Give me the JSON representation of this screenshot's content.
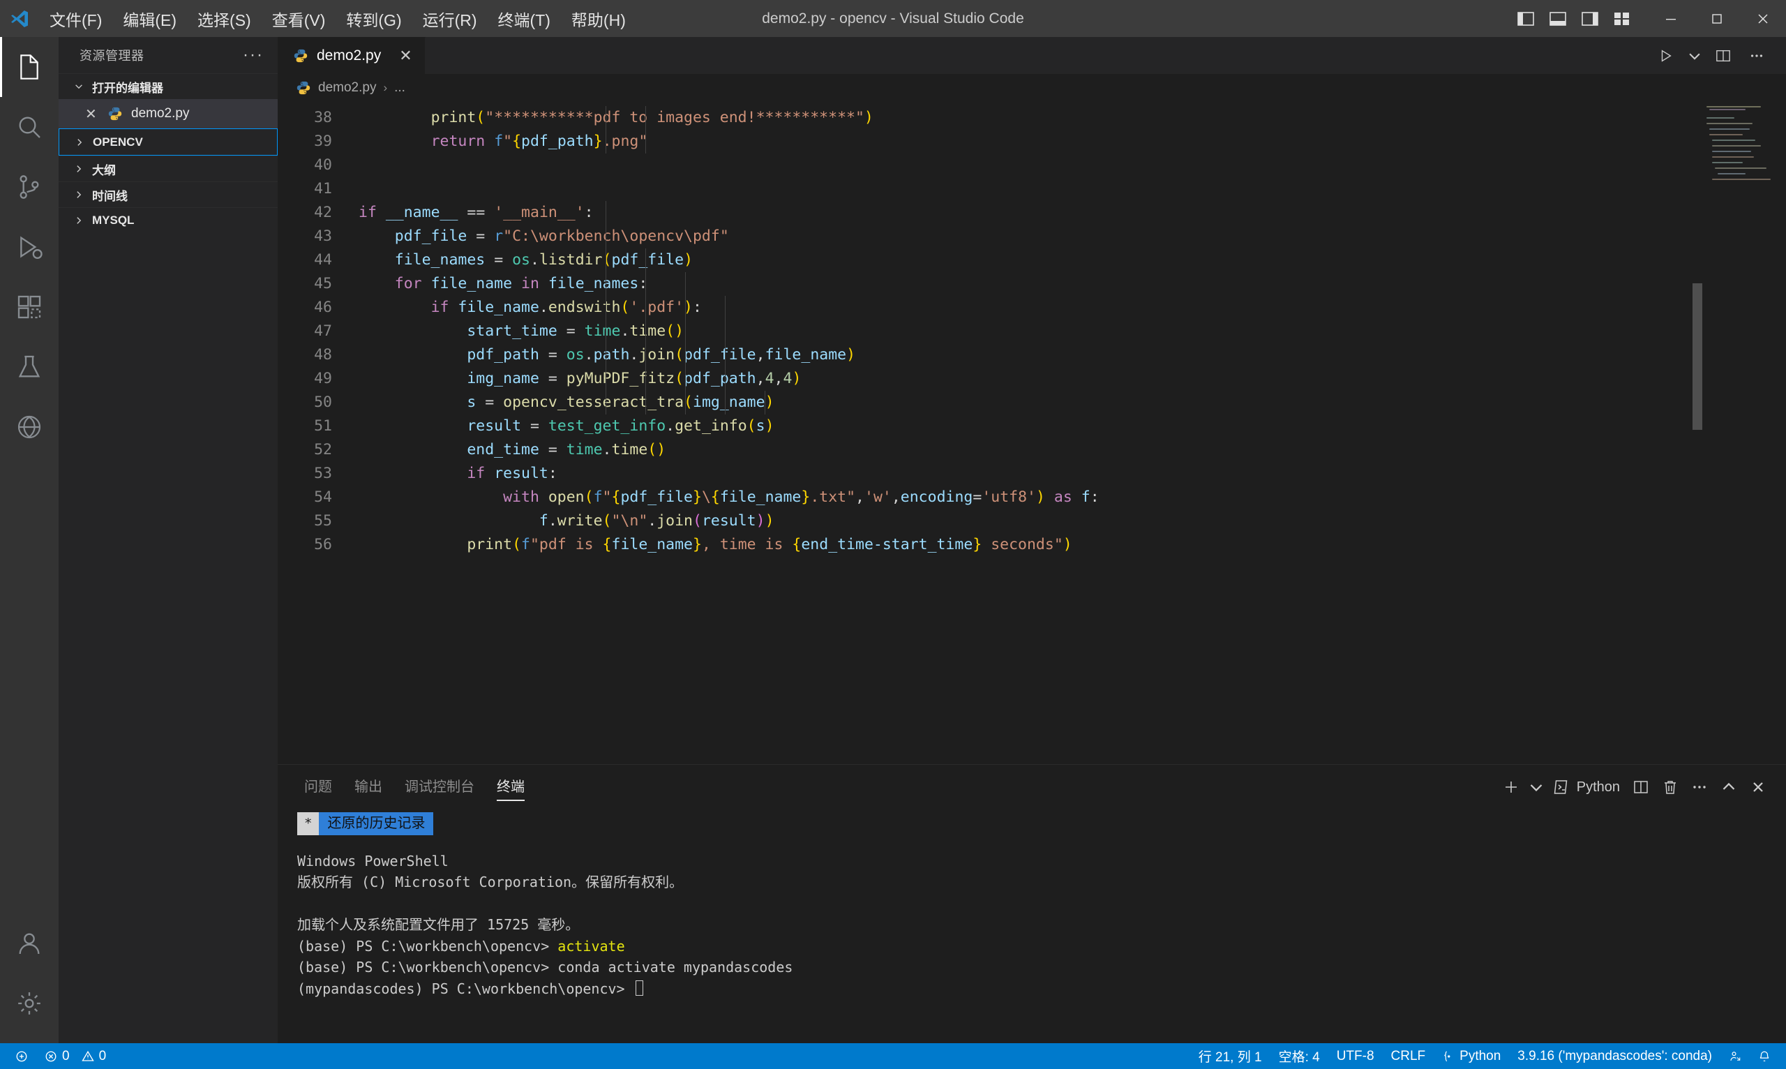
{
  "window": {
    "title": "demo2.py - opencv - Visual Studio Code",
    "menus": [
      "文件(F)",
      "编辑(E)",
      "选择(S)",
      "查看(V)",
      "转到(G)",
      "运行(R)",
      "终端(T)",
      "帮助(H)"
    ],
    "layout_icons": [
      "toggle-primary-sidebar-icon",
      "toggle-panel-icon",
      "toggle-secondary-sidebar-icon",
      "customize-layout-icon"
    ],
    "controls": [
      "minimize",
      "maximize",
      "close"
    ]
  },
  "activitybar": {
    "items": [
      {
        "name": "explorer",
        "icon": "files-icon",
        "active": true
      },
      {
        "name": "search",
        "icon": "search-icon",
        "active": false
      },
      {
        "name": "source-control",
        "icon": "source-control-icon",
        "active": false
      },
      {
        "name": "run-debug",
        "icon": "run-debug-icon",
        "active": false
      },
      {
        "name": "extensions",
        "icon": "extensions-icon",
        "active": false
      },
      {
        "name": "testing",
        "icon": "beaker-icon",
        "active": false
      },
      {
        "name": "chatgpt",
        "icon": "chatgpt-icon",
        "active": false
      }
    ],
    "bottom": [
      {
        "name": "accounts",
        "icon": "account-icon"
      },
      {
        "name": "settings",
        "icon": "gear-icon"
      }
    ]
  },
  "sidebar": {
    "title": "资源管理器",
    "more_label": "···",
    "sections": [
      {
        "label": "打开的编辑器",
        "expanded": true,
        "focused": false
      },
      {
        "label": "OPENCV",
        "expanded": false,
        "focused": true
      },
      {
        "label": "大纲",
        "expanded": false,
        "focused": false
      },
      {
        "label": "时间线",
        "expanded": false,
        "focused": false
      },
      {
        "label": "MYSQL",
        "expanded": false,
        "focused": false
      }
    ],
    "open_editors": [
      {
        "name": "demo2.py",
        "icon": "python-icon",
        "close": "✕"
      }
    ]
  },
  "editor": {
    "tabs": [
      {
        "label": "demo2.py",
        "icon": "python-icon",
        "close": "✕",
        "active": true
      }
    ],
    "tab_actions": [
      "run-python-file-icon",
      "chevron-down-icon",
      "split-editor-icon",
      "more-actions-icon"
    ],
    "breadcrumb": {
      "file": "demo2.py",
      "sep": "›",
      "rest": "..."
    },
    "first_line_number": 38,
    "lines": [
      {
        "n": 38,
        "indent": 2,
        "text": "print(\"***********pdf to images end!***********\")"
      },
      {
        "n": 39,
        "indent": 2,
        "text": "return f\"{pdf_path}.png\""
      },
      {
        "n": 40,
        "indent": 0,
        "text": ""
      },
      {
        "n": 41,
        "indent": 0,
        "text": ""
      },
      {
        "n": 42,
        "indent": 0,
        "text": "if __name__ == '__main__':"
      },
      {
        "n": 43,
        "indent": 1,
        "text": "pdf_file = r\"C:\\workbench\\opencv\\pdf\""
      },
      {
        "n": 44,
        "indent": 1,
        "text": "file_names = os.listdir(pdf_file)"
      },
      {
        "n": 45,
        "indent": 1,
        "text": "for file_name in file_names:"
      },
      {
        "n": 46,
        "indent": 2,
        "text": "if file_name.endswith('.pdf'):"
      },
      {
        "n": 47,
        "indent": 3,
        "text": "start_time = time.time()"
      },
      {
        "n": 48,
        "indent": 3,
        "text": "pdf_path = os.path.join(pdf_file,file_name)"
      },
      {
        "n": 49,
        "indent": 3,
        "text": "img_name = pyMuPDF_fitz(pdf_path,4,4)"
      },
      {
        "n": 50,
        "indent": 3,
        "text": "s = opencv_tesseract_tra(img_name)"
      },
      {
        "n": 51,
        "indent": 3,
        "text": "result = test_get_info.get_info(s)"
      },
      {
        "n": 52,
        "indent": 3,
        "text": "end_time = time.time()"
      },
      {
        "n": 53,
        "indent": 3,
        "text": "if result:"
      },
      {
        "n": 54,
        "indent": 4,
        "text": "with open(f\"{pdf_file}\\{file_name}.txt\",'w',encoding='utf8') as f:"
      },
      {
        "n": 55,
        "indent": 5,
        "text": "f.write(\"\\n\".join(result))"
      },
      {
        "n": 56,
        "indent": 3,
        "text": "print(f\"pdf is {file_name}, time is {end_time-start_time} seconds\")"
      }
    ]
  },
  "panel": {
    "tabs": [
      {
        "label": "问题",
        "active": false
      },
      {
        "label": "输出",
        "active": false
      },
      {
        "label": "调试控制台",
        "active": false
      },
      {
        "label": "终端",
        "active": true
      }
    ],
    "actions": {
      "new_terminal": "+",
      "chevron": "chevron-down-icon",
      "shell_label": "Python",
      "split": "split-terminal-icon",
      "kill": "trash-icon",
      "more": "···",
      "maximize": "chevron-up-icon",
      "close": "✕"
    },
    "restore_chip": {
      "star": "*",
      "label": "还原的历史记录"
    },
    "terminal_lines": [
      {
        "text": "Windows PowerShell",
        "type": "plain"
      },
      {
        "text": "版权所有 (C) Microsoft Corporation。保留所有权利。",
        "type": "plain"
      },
      {
        "text": "",
        "type": "plain"
      },
      {
        "text": "加载个人及系统配置文件用了 15725 毫秒。",
        "type": "plain"
      },
      {
        "prompt": "(base) PS C:\\workbench\\opencv> ",
        "cmd": "activate",
        "type": "cmd-highlight"
      },
      {
        "prompt": "(base) PS C:\\workbench\\opencv> ",
        "cmd": "conda activate mypandascodes",
        "type": "cmd"
      },
      {
        "prompt": "(mypandascodes) PS C:\\workbench\\opencv> ",
        "cmd": "",
        "type": "cursor"
      }
    ]
  },
  "statusbar": {
    "left": [
      {
        "icon": "remote-icon",
        "label": ""
      },
      {
        "icon": "error-icon",
        "label": "0"
      },
      {
        "icon": "warning-icon",
        "label": "0"
      }
    ],
    "errors": "0",
    "warnings": "0",
    "right": [
      {
        "name": "cursor-position",
        "label": "行 21, 列 1"
      },
      {
        "name": "indentation",
        "label": "空格: 4"
      },
      {
        "name": "encoding",
        "label": "UTF-8"
      },
      {
        "name": "eol",
        "label": "CRLF"
      },
      {
        "name": "language-mode",
        "label": "Python"
      },
      {
        "name": "python-interpreter",
        "label": "3.9.16 ('mypandascodes': conda)"
      },
      {
        "name": "live-share",
        "label": ""
      },
      {
        "name": "notifications",
        "label": ""
      }
    ]
  },
  "colors": {
    "accent": "#007acc",
    "titlebar_bg": "#3c3c3c",
    "sidebar_bg": "#252526",
    "editor_bg": "#1e1e1e",
    "activitybar_bg": "#333333",
    "focus_border": "#0097fb",
    "terminal_highlight": "#2f7fd8"
  }
}
